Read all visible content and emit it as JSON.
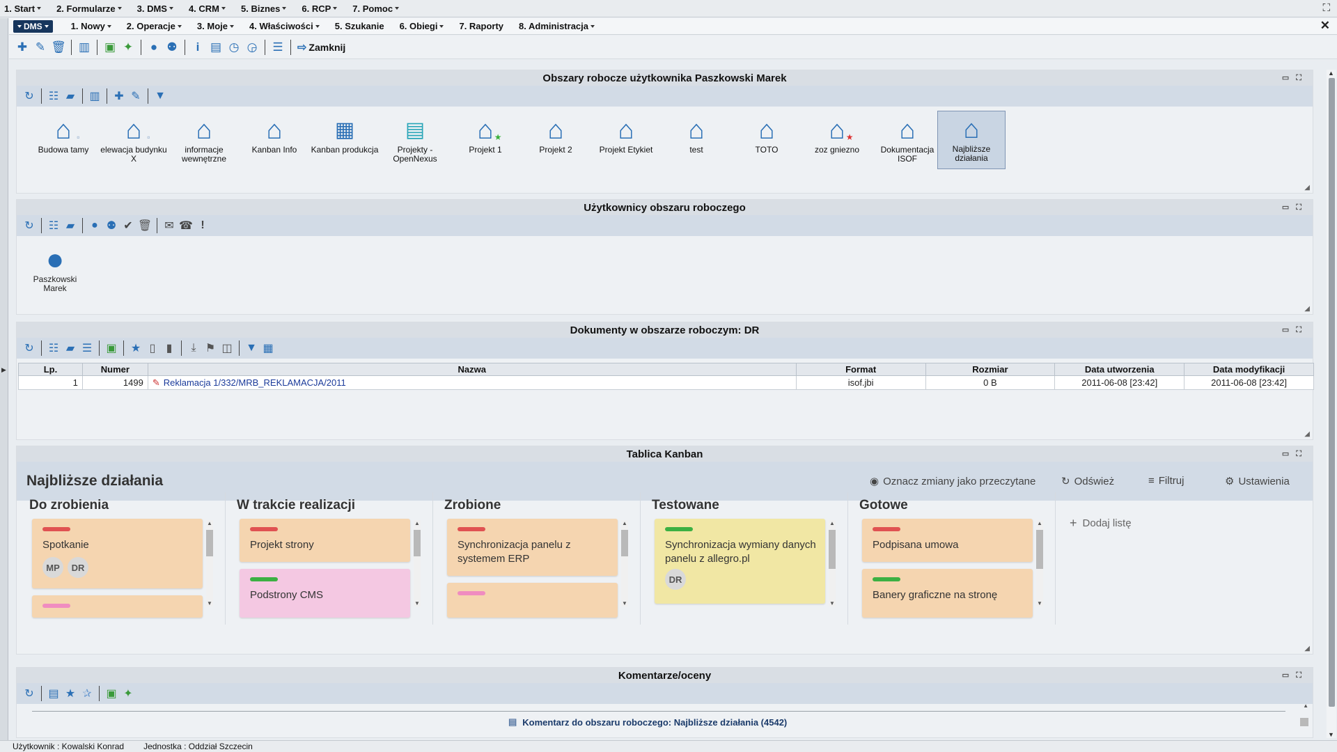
{
  "top_menu": [
    {
      "label": "1. Start"
    },
    {
      "label": "2. Formularze"
    },
    {
      "label": "3. DMS"
    },
    {
      "label": "4. CRM"
    },
    {
      "label": "5. Biznes"
    },
    {
      "label": "6. RCP"
    },
    {
      "label": "7. Pomoc"
    }
  ],
  "dms_menu": {
    "badge": "DMS",
    "items": [
      {
        "label": "1. Nowy",
        "caret": true
      },
      {
        "label": "2. Operacje",
        "caret": true
      },
      {
        "label": "3. Moje",
        "caret": true
      },
      {
        "label": "4. Właściwości",
        "caret": true
      },
      {
        "label": "5. Szukanie",
        "caret": false
      },
      {
        "label": "6. Obiegi",
        "caret": true
      },
      {
        "label": "7. Raporty",
        "caret": false
      },
      {
        "label": "8. Administracja",
        "caret": true
      }
    ]
  },
  "toolbar": {
    "close_label": "Zamknij"
  },
  "workspaces": {
    "title": "Obszary robocze użytkownika Paszkowski Marek",
    "items": [
      {
        "label": "Budowa tamy",
        "icon": "house-icon"
      },
      {
        "label": "elewacja budynku X",
        "icon": "house-icon"
      },
      {
        "label": "informacje wewnętrzne",
        "icon": "house-icon"
      },
      {
        "label": "Kanban Info",
        "icon": "house-icon"
      },
      {
        "label": "Kanban produkcja",
        "icon": "kanban-icon"
      },
      {
        "label": "Projekty - OpenNexus",
        "icon": "document-icon"
      },
      {
        "label": "Projekt 1",
        "icon": "house-icon"
      },
      {
        "label": "Projekt 2",
        "icon": "house-icon"
      },
      {
        "label": "Projekt Etykiet",
        "icon": "house-icon"
      },
      {
        "label": "test",
        "icon": "house-icon"
      },
      {
        "label": "TOTO",
        "icon": "house-icon"
      },
      {
        "label": "zoz gniezno",
        "icon": "house-icon"
      },
      {
        "label": "Dokumentacja ISOF",
        "icon": "house-icon"
      },
      {
        "label": "Najbliższe działania",
        "icon": "house-icon"
      }
    ]
  },
  "users_panel": {
    "title": "Użytkownicy obszaru roboczego",
    "users": [
      {
        "name": "Paszkowski Marek"
      }
    ]
  },
  "documents": {
    "title": "Dokumenty w obszarze roboczym: DR",
    "columns": [
      "Lp.",
      "Numer",
      "Nazwa",
      "Format",
      "Rozmiar",
      "Data utworzenia",
      "Data modyfikacji"
    ],
    "rows": [
      {
        "lp": "1",
        "numer": "1499",
        "nazwa": "Reklamacja 1/332/MRB_REKLAMACJA/2011",
        "format": "isof.jbi",
        "rozmiar": "0 B",
        "utworzenia": "2011-06-08 [23:42]",
        "modyfikacji": "2011-06-08 [23:42]"
      }
    ]
  },
  "kanban": {
    "panel_title": "Tablica Kanban",
    "board_title": "Najbliższe działania",
    "actions": {
      "mark_read": "Oznacz zmiany jako przeczytane",
      "refresh": "Odśwież",
      "filter": "Filtruj",
      "settings": "Ustawienia"
    },
    "add_list": "Dodaj listę",
    "columns": [
      {
        "title": "Do zrobienia",
        "cards": [
          {
            "text": "Spotkanie",
            "stripe": "#e05252",
            "bg": "#f5d5b0",
            "avatars": [
              "MP",
              "DR"
            ]
          },
          {
            "text": "",
            "stripe": "#f08cc0",
            "bg": "#f5d5b0",
            "avatars": []
          }
        ]
      },
      {
        "title": "W trakcie realizacji",
        "cards": [
          {
            "text": "Projekt strony",
            "stripe": "#e05252",
            "bg": "#f5d5b0",
            "avatars": []
          },
          {
            "text": "Podstrony CMS",
            "stripe": "#3cb043",
            "bg": "#f4c8e2",
            "avatars": []
          }
        ]
      },
      {
        "title": "Zrobione",
        "cards": [
          {
            "text": "Synchronizacja panelu z systemem ERP",
            "stripe": "#e05252",
            "bg": "#f5d5b0",
            "avatars": []
          },
          {
            "text": "",
            "stripe": "#f08cc0",
            "bg": "#f5d5b0",
            "avatars": []
          }
        ]
      },
      {
        "title": "Testowane",
        "cards": [
          {
            "text": "Synchronizacja wymiany danych panelu z allegro.pl",
            "stripe": "#3cb043",
            "bg": "#f1e7a4",
            "avatars": [
              "DR"
            ]
          }
        ]
      },
      {
        "title": "Gotowe",
        "cards": [
          {
            "text": "Podpisana umowa",
            "stripe": "#e05252",
            "bg": "#f5d5b0",
            "avatars": []
          },
          {
            "text": "Banery graficzne na stronę",
            "stripe": "#3cb043",
            "bg": "#f5d5b0",
            "avatars": []
          }
        ]
      }
    ]
  },
  "comments": {
    "title": "Komentarze/oceny",
    "item": "Komentarz do obszaru roboczego: Najbliższe działania (4542)"
  },
  "status": {
    "user": "Użytkownik : Kowalski Konrad",
    "unit": "Jednostka : Oddział Szczecin"
  }
}
